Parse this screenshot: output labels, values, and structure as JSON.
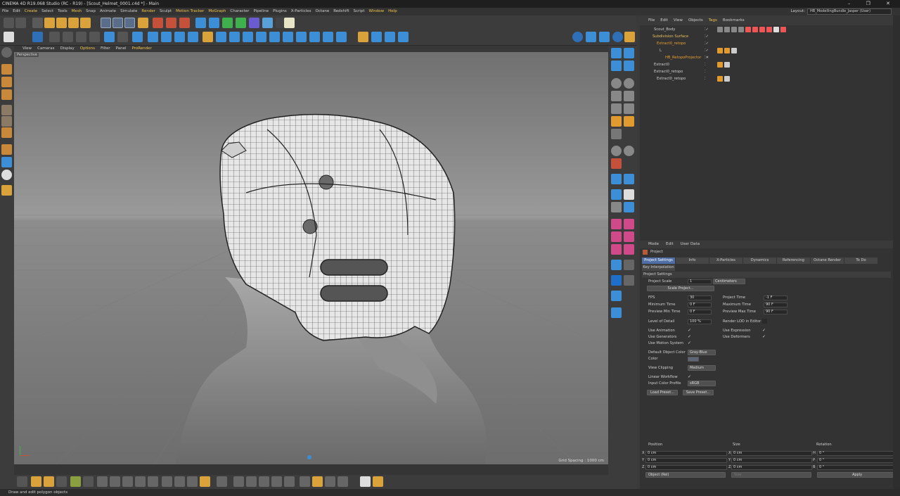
{
  "window": {
    "title": "CINEMA 4D R19.068 Studio (RC - R19) - [Scout_Helmet_0001.c4d *] - Main",
    "controls": "–  ❐  ✕"
  },
  "menubar": [
    "File",
    "Edit",
    "Create",
    "Select",
    "Tools",
    "Mesh",
    "Snap",
    "Animate",
    "Simulate",
    "Render",
    "Sculpt",
    "Motion Tracker",
    "MoGraph",
    "Character",
    "Pipeline",
    "Plugins",
    "X-Particles",
    "Octane",
    "Redshift",
    "Script",
    "Window",
    "Help"
  ],
  "layout": {
    "label": "Layout:",
    "value": "HB_ModellingBundle_Jasper (User)"
  },
  "viewport": {
    "menu": [
      "View",
      "Cameras",
      "Display",
      "Options",
      "Filter",
      "Panel",
      "ProRender"
    ],
    "camera_label": "Perspective",
    "grid_spacing": "Grid Spacing : 1000 cm"
  },
  "object_manager": {
    "menu": [
      "File",
      "Edit",
      "View",
      "Objects",
      "Tags",
      "Bookmarks"
    ],
    "objects": [
      {
        "name": "Scout_Body",
        "color": "#d0d0d0"
      },
      {
        "name": "Subdivision Surface",
        "color": "#e6c15a"
      },
      {
        "name": "Extract0_retopo",
        "color": "#e6a030"
      },
      {
        "name": "L",
        "color": "#d0d0d0"
      },
      {
        "name": "HB_RetopoProjector",
        "color": "#e6a030"
      },
      {
        "name": "Extract0",
        "color": "#d0d0d0"
      },
      {
        "name": "Extract0_retopo",
        "color": "#d0d0d0"
      },
      {
        "name": "Extract0_retopo",
        "color": "#d0d0d0"
      }
    ]
  },
  "attribute_manager": {
    "menu": [
      "Mode",
      "Edit",
      "User Data"
    ],
    "title": "Project",
    "tabs": [
      "Project Settings",
      "Info",
      "X-Particles",
      "Dynamics",
      "Referencing",
      "Octane Render",
      "To Do"
    ],
    "tab2": "Key Interpolation",
    "section": "Project Settings",
    "project_scale": {
      "label": "Project Scale",
      "value": "1",
      "unit": "Centimeters"
    },
    "scale_button": "Scale Project...",
    "fps": {
      "label": "FPS",
      "value": "30"
    },
    "project_time": {
      "label": "Project Time",
      "value": "-1 F"
    },
    "min_time": {
      "label": "Minimum Time",
      "value": "0 F"
    },
    "max_time": {
      "label": "Maximum Time",
      "value": "90 F"
    },
    "prev_min": {
      "label": "Preview Min Time",
      "value": "0 F"
    },
    "prev_max": {
      "label": "Preview Max Time",
      "value": "90 F"
    },
    "lod": {
      "label": "Level of Detail",
      "value": "100 %"
    },
    "render_lod": "Render LOD in Editor",
    "use_animation": "Use Animation",
    "use_expression": "Use Expression",
    "use_generators": "Use Generators",
    "use_deformers": "Use Deformers",
    "use_motion": "Use Motion System",
    "default_color": {
      "label": "Default Object Color",
      "value": "Gray-Blue"
    },
    "color": {
      "label": "Color"
    },
    "view_clipping": {
      "label": "View Clipping",
      "value": "Medium"
    },
    "linear_workflow": "Linear Workflow",
    "input_color_profile": {
      "label": "Input Color Profile",
      "value": "sRGB"
    },
    "load_preset": "Load Preset...",
    "save_preset": "Save Preset..."
  },
  "coordinates": {
    "headers": [
      "Position",
      "Size",
      "Rotation"
    ],
    "rows": [
      {
        "axis": "X",
        "pos": "0 cm",
        "size_axis": "X",
        "size": "0 cm",
        "rot_axis": "H",
        "rot": "0 °"
      },
      {
        "axis": "Y",
        "pos": "0 cm",
        "size_axis": "Y",
        "size": "0 cm",
        "rot_axis": "P",
        "rot": "0 °"
      },
      {
        "axis": "Z",
        "pos": "0 cm",
        "size_axis": "Z",
        "size": "0 cm",
        "rot_axis": "B",
        "rot": "0 °"
      }
    ],
    "mode": "Object (Rel)",
    "size_mode": "Size",
    "apply": "Apply"
  },
  "status": "Draw and edit polygon objects"
}
